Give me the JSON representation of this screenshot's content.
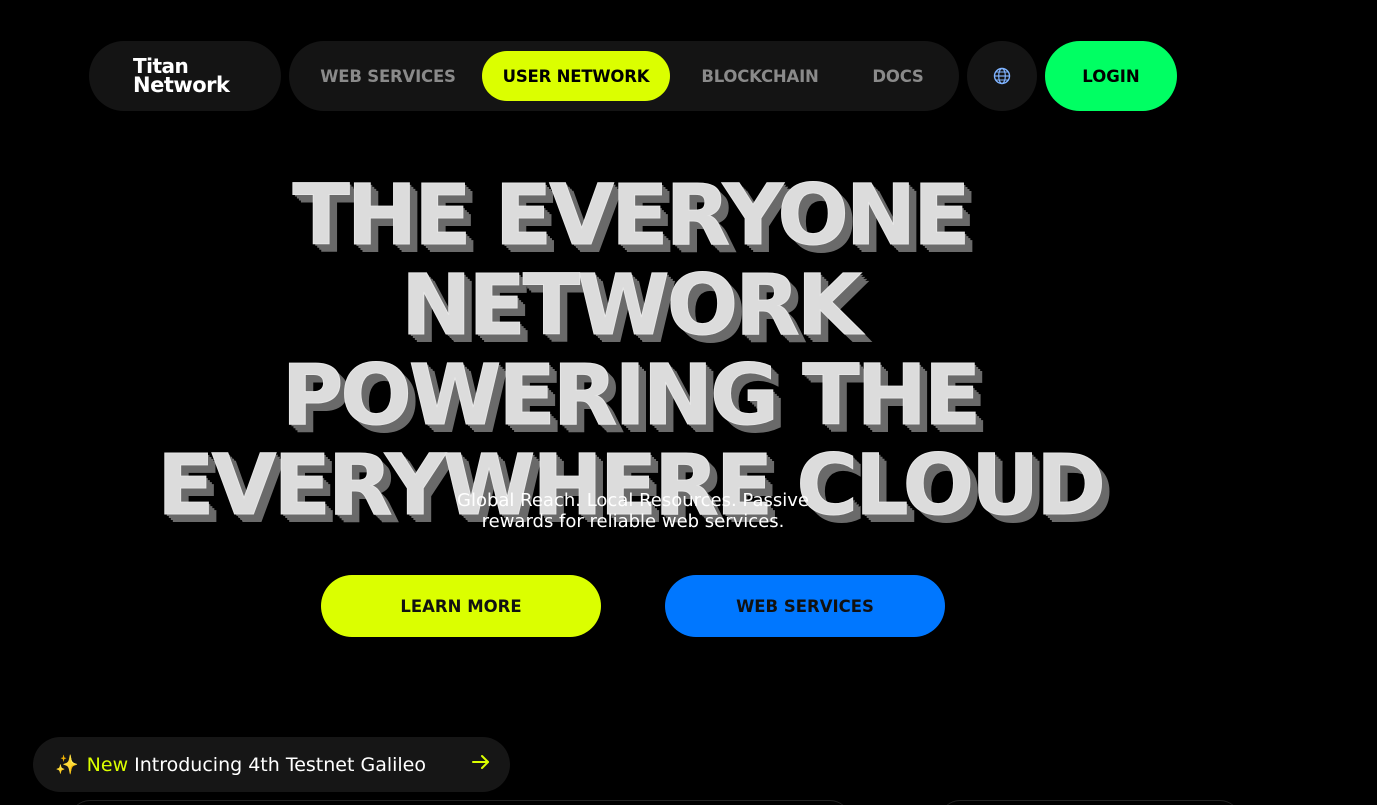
{
  "brand": {
    "logo_line1": "Titan",
    "logo_line2": "Network"
  },
  "nav": {
    "items": [
      {
        "label": "WEB SERVICES",
        "active": false
      },
      {
        "label": "USER NETWORK",
        "active": true
      },
      {
        "label": "BLOCKCHAIN",
        "active": false
      },
      {
        "label": "DOCS",
        "active": false
      }
    ],
    "language_icon": "globe-icon",
    "login_label": "LOGIN"
  },
  "hero": {
    "title_lines": [
      "THE EVERYONE NETWORK",
      "POWERING THE",
      "EVERYWHERE CLOUD"
    ],
    "subtitle_lines": [
      "Global Reach. Local Resources. Passive",
      "rewards for reliable web services."
    ],
    "primary_cta": "LEARN MORE",
    "secondary_cta": "WEB SERVICES"
  },
  "announcement": {
    "icon": "sparkles-icon",
    "badge": "New",
    "text": "Introducing 4th Testnet Galileo",
    "arrow_icon": "arrow-right-icon"
  },
  "colors": {
    "background": "#000000",
    "accent_lime": "#dbff00",
    "accent_green": "#00ff63",
    "accent_blue": "#0077ff",
    "pill_bg": "#141414"
  }
}
